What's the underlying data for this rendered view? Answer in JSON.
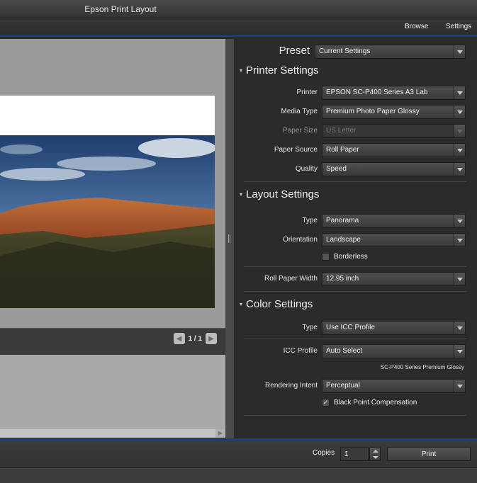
{
  "window": {
    "title": "Epson Print Layout"
  },
  "nav": {
    "browse": "Browse",
    "settings": "Settings"
  },
  "preview": {
    "page_indicator": "1 / 1"
  },
  "preset": {
    "label": "Preset",
    "value": "Current Settings"
  },
  "printer_settings": {
    "title": "Printer Settings",
    "printer": {
      "label": "Printer",
      "value": "EPSON SC-P400 Series A3 Lab"
    },
    "media_type": {
      "label": "Media Type",
      "value": "Premium Photo Paper Glossy"
    },
    "paper_size": {
      "label": "Paper Size",
      "value": "US Letter"
    },
    "paper_source": {
      "label": "Paper Source",
      "value": "Roll Paper"
    },
    "quality": {
      "label": "Quality",
      "value": "Speed"
    }
  },
  "layout_settings": {
    "title": "Layout Settings",
    "type": {
      "label": "Type",
      "value": "Panorama"
    },
    "orientation": {
      "label": "Orientation",
      "value": "Landscape"
    },
    "borderless": {
      "label": "Borderless",
      "checked": false
    },
    "roll_paper_width": {
      "label": "Roll Paper Width",
      "value": "12.95 inch"
    }
  },
  "color_settings": {
    "title": "Color Settings",
    "type": {
      "label": "Type",
      "value": "Use ICC Profile"
    },
    "icc_profile": {
      "label": "ICC Profile",
      "value": "Auto Select"
    },
    "profile_name": "SC-P400 Series Premium Glossy",
    "rendering_intent": {
      "label": "Rendering Intent",
      "value": "Perceptual"
    },
    "black_point": {
      "label": "Black Point Compensation",
      "checked": true,
      "mark": "✓"
    }
  },
  "bottom": {
    "copies_label": "Copies",
    "copies_value": "1",
    "print_label": "Print"
  },
  "icons": {
    "expand": "▾",
    "prev": "◀",
    "next": "▶"
  }
}
